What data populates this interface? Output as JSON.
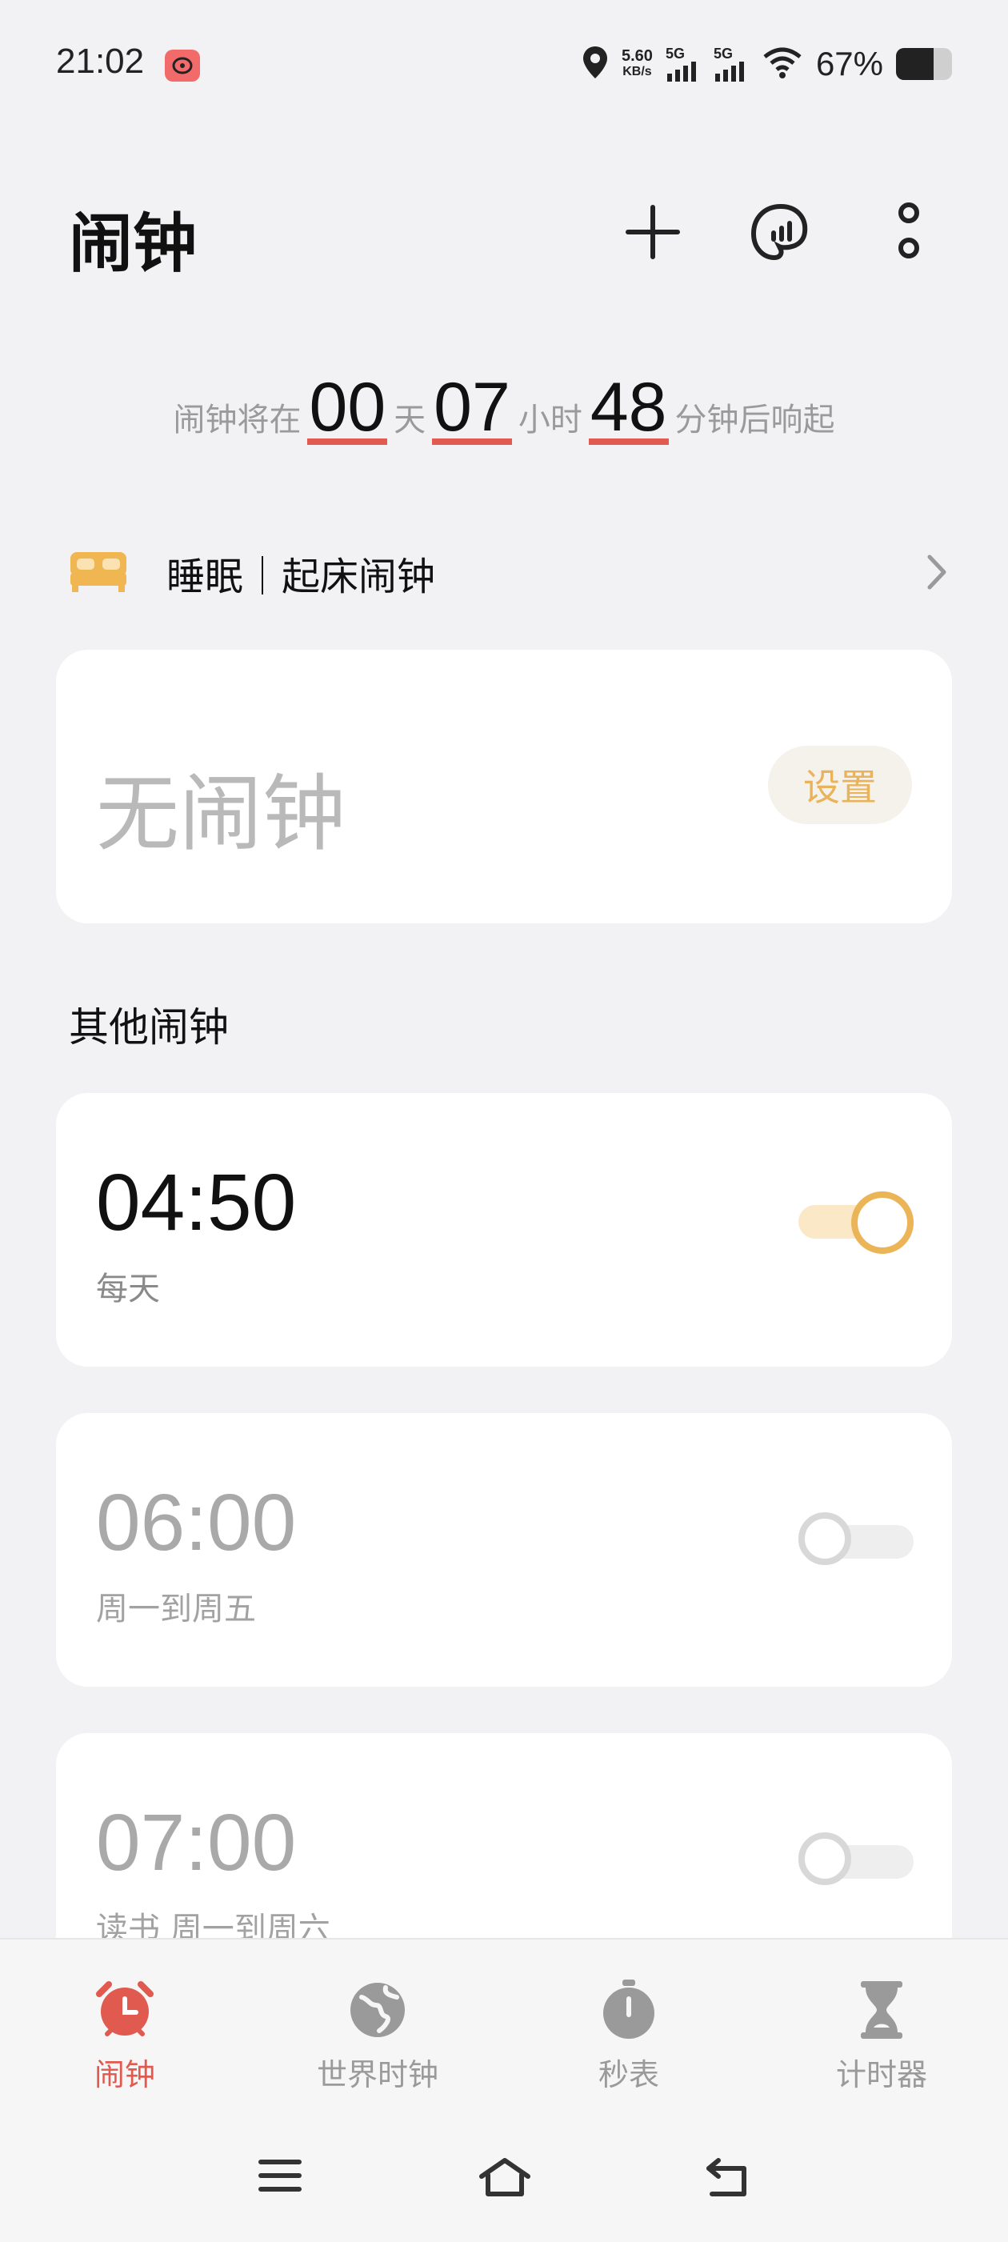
{
  "status_bar": {
    "time": "21:02",
    "speed_value": "5.60",
    "speed_unit": "KB/s",
    "net1": "5G",
    "net2": "5G",
    "battery_percent": "67%",
    "battery_level": 0.67
  },
  "header": {
    "title": "闹钟",
    "icons": [
      "add-icon",
      "sleep-stats-icon",
      "more-icon"
    ]
  },
  "countdown": {
    "prefix": "闹钟将在",
    "days": "00",
    "days_unit": "天",
    "hours": "07",
    "hours_unit": "小时",
    "minutes": "48",
    "minutes_unit": "分钟后响起"
  },
  "sleep": {
    "label": "睡眠｜起床闹钟",
    "empty_text": "无闹钟",
    "set_button": "设置"
  },
  "other_alarms": {
    "section_title": "其他闹钟",
    "items": [
      {
        "time": "04:50",
        "repeat": "每天",
        "enabled": true
      },
      {
        "time": "06:00",
        "repeat": "周一到周五",
        "enabled": false
      },
      {
        "time": "07:00",
        "repeat": "读书 周一到周六",
        "enabled": false
      }
    ]
  },
  "bottom_nav": {
    "items": [
      {
        "label": "闹钟",
        "icon": "alarm-clock-icon",
        "active": true
      },
      {
        "label": "世界时钟",
        "icon": "globe-icon",
        "active": false
      },
      {
        "label": "秒表",
        "icon": "stopwatch-icon",
        "active": false
      },
      {
        "label": "计时器",
        "icon": "hourglass-icon",
        "active": false
      }
    ]
  },
  "colors": {
    "accent": "#e05a50",
    "toggle_on": "#eab457",
    "set_button_text": "#e9b35c"
  }
}
